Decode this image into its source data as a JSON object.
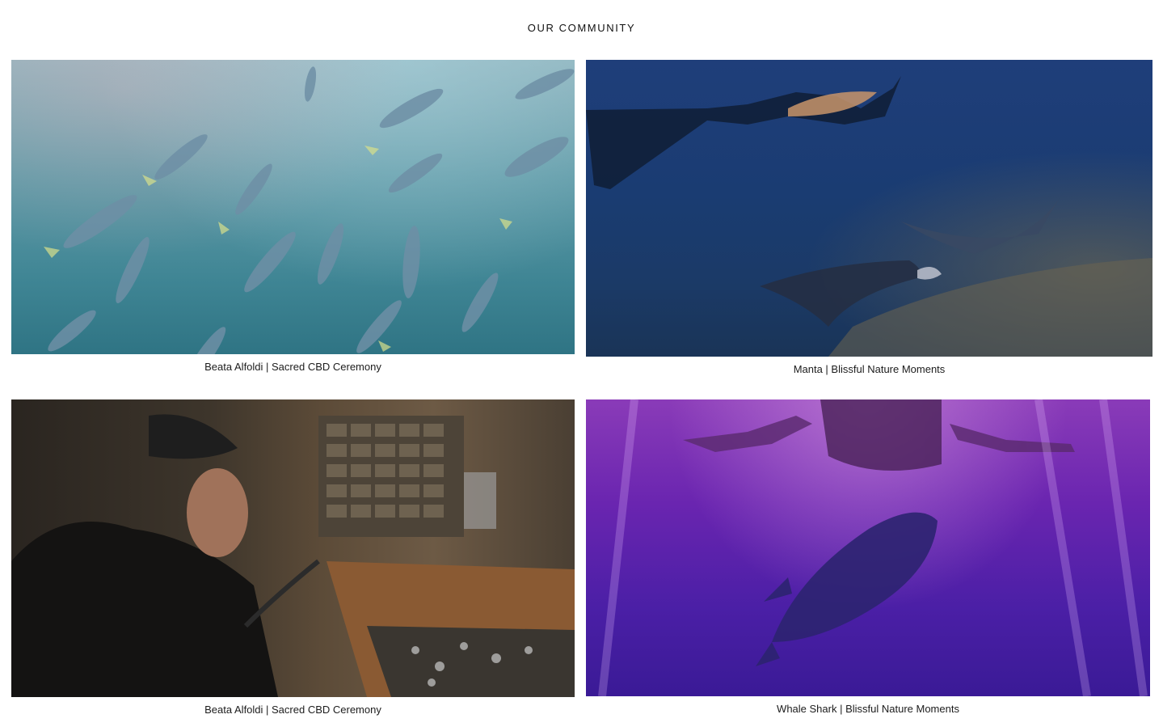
{
  "section": {
    "title": "OUR COMMUNITY"
  },
  "videos": [
    {
      "caption": "Beata Alfoldi | Sacred CBD Ceremony"
    },
    {
      "caption": "Manta | Blissful Nature Moments"
    },
    {
      "caption": "Beata Alfoldi | Sacred CBD Ceremony"
    },
    {
      "caption": "Whale Shark | Blissful Nature Moments"
    }
  ]
}
